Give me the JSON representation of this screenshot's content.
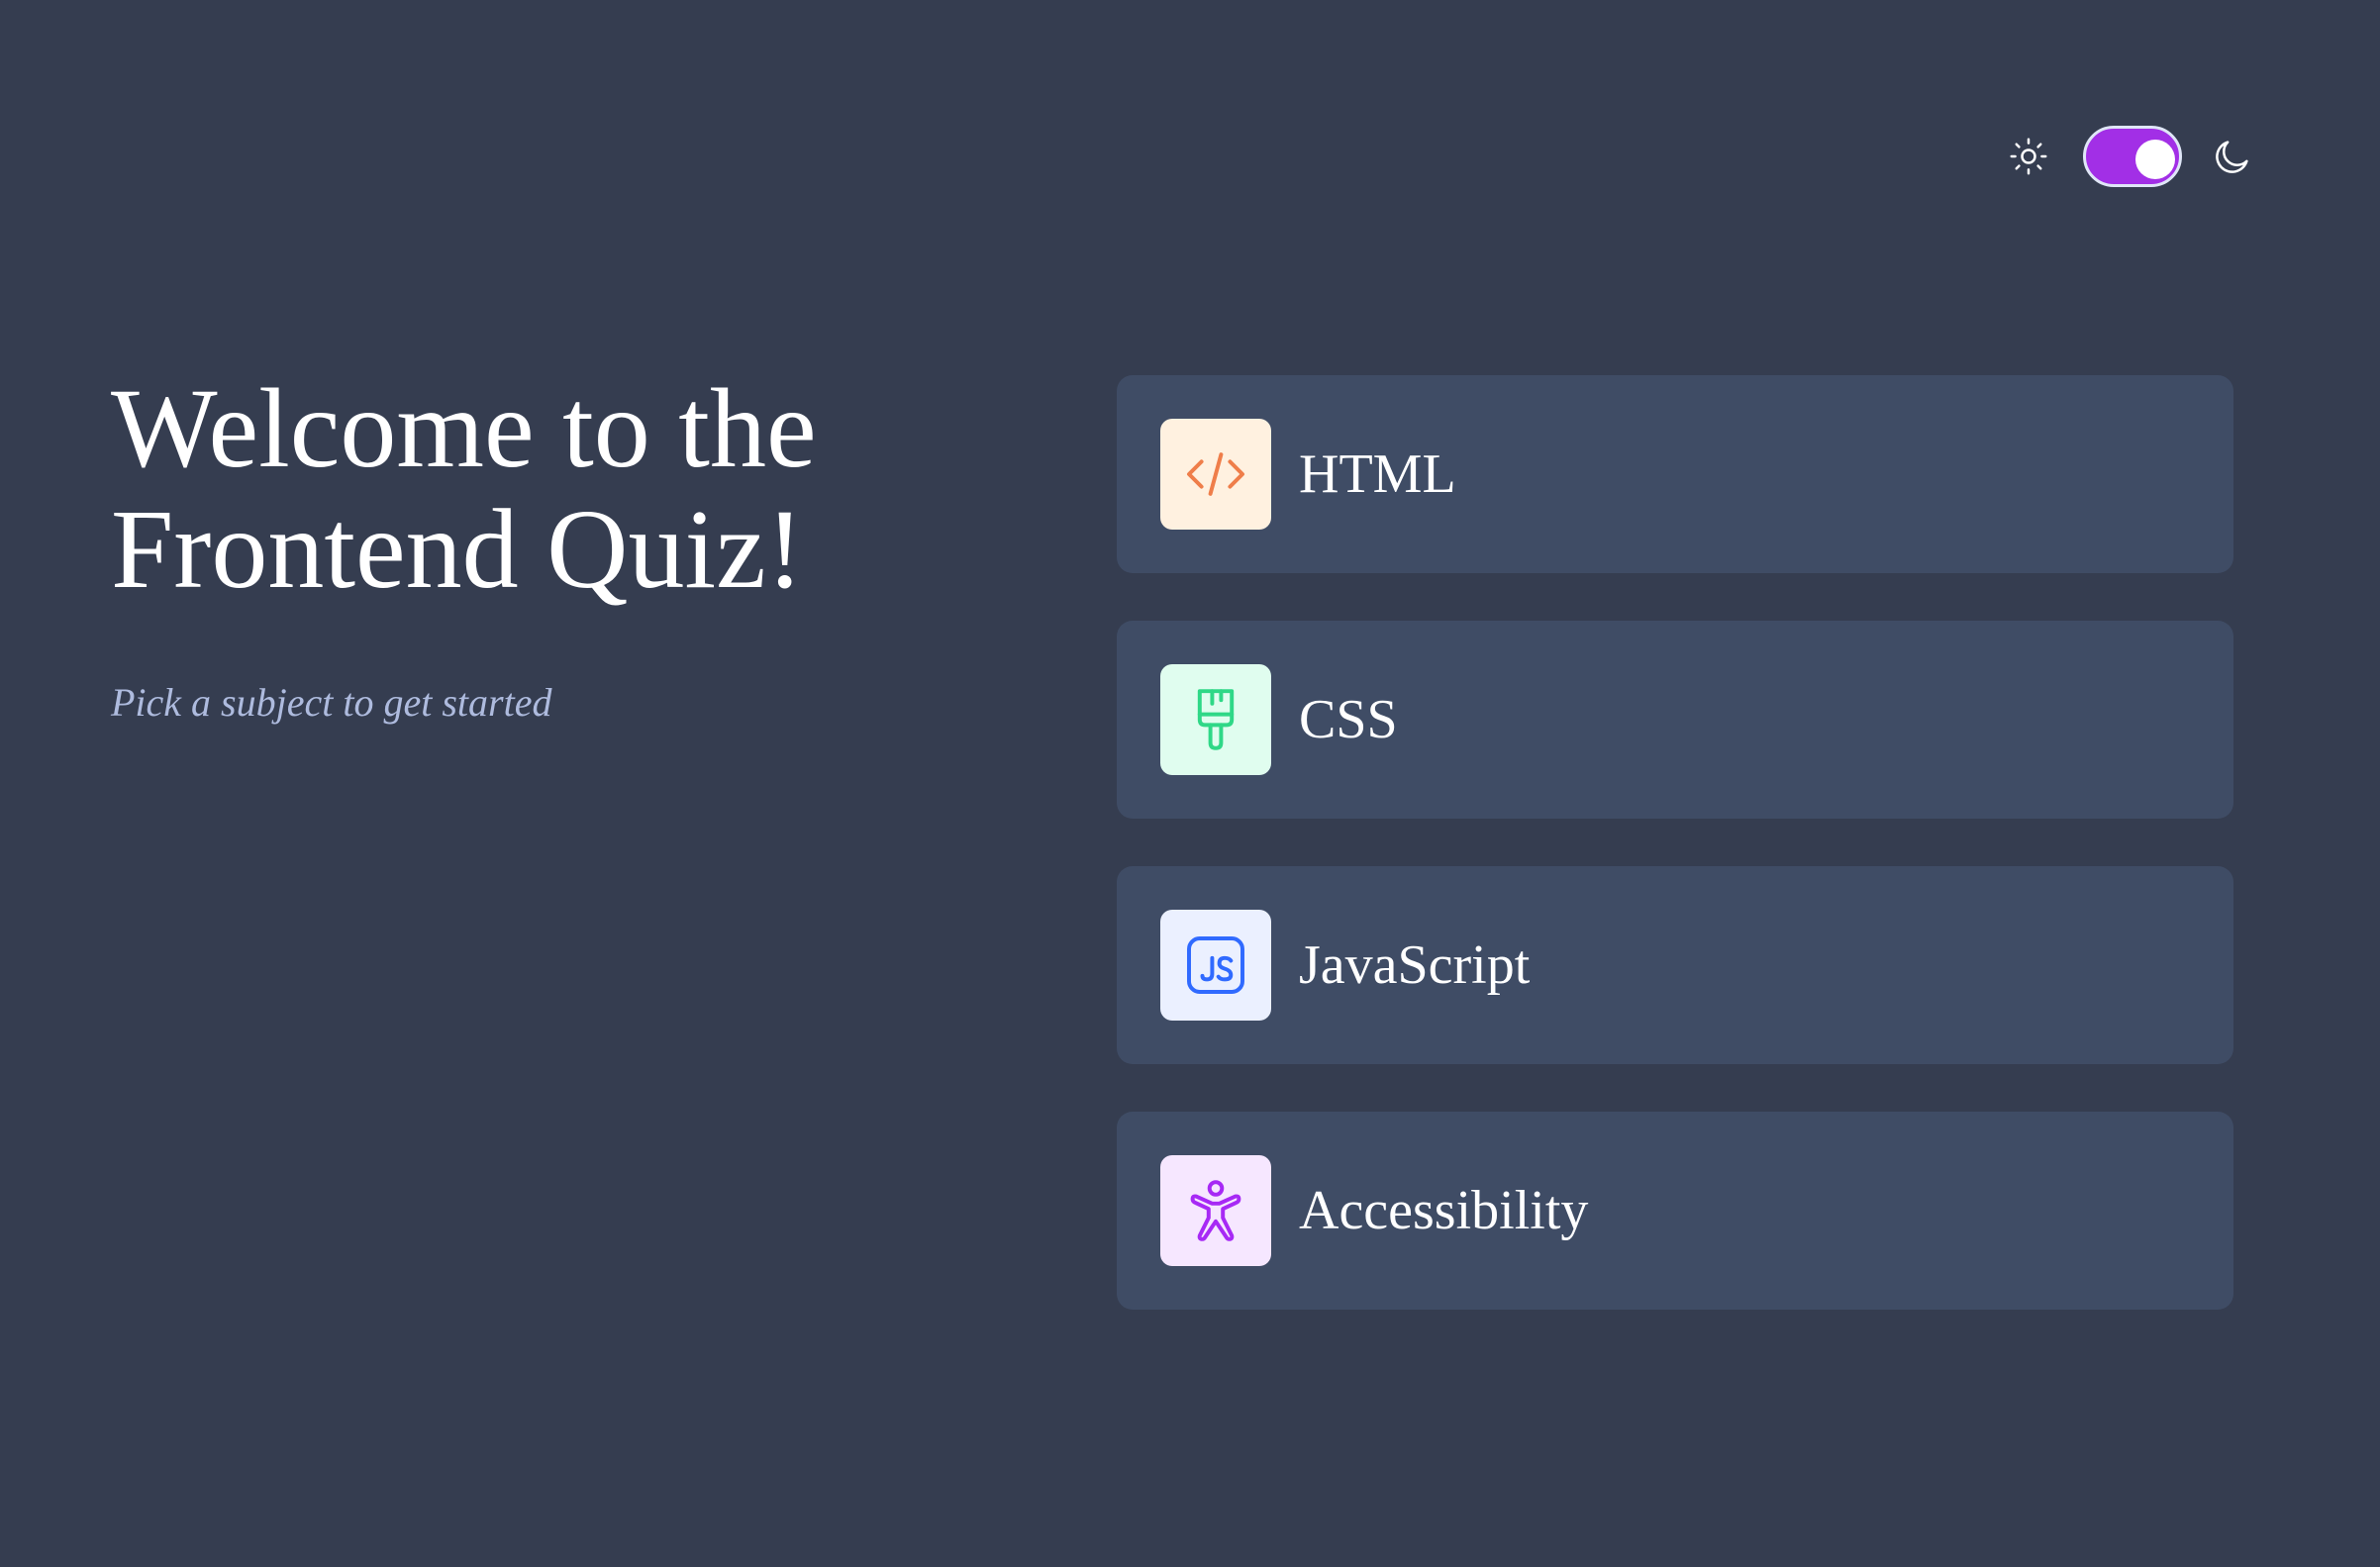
{
  "theme_toggle": {
    "light_icon": "sun-icon",
    "dark_icon": "moon-icon",
    "state": "dark",
    "accent_color": "#a22fe6"
  },
  "intro": {
    "title_line1": "Welcome to the",
    "title_line2": "Frontend Quiz!",
    "subtitle": "Pick a subject to get started"
  },
  "subjects": [
    {
      "label": "HTML",
      "icon": "code-icon",
      "icon_bg": "#fff1e0",
      "icon_color": "#ef7e4a"
    },
    {
      "label": "CSS",
      "icon": "paintbrush-icon",
      "icon_bg": "#e0fdef",
      "icon_color": "#2fd887"
    },
    {
      "label": "JavaScript",
      "icon": "js-icon",
      "icon_bg": "#ebf0ff",
      "icon_color": "#306aff"
    },
    {
      "label": "Accessibility",
      "icon": "accessibility-icon",
      "icon_bg": "#f6e7ff",
      "icon_color": "#a729f5"
    }
  ],
  "colors": {
    "background": "#353d50",
    "card": "#3f4c65",
    "subtitle": "#aebbde"
  }
}
